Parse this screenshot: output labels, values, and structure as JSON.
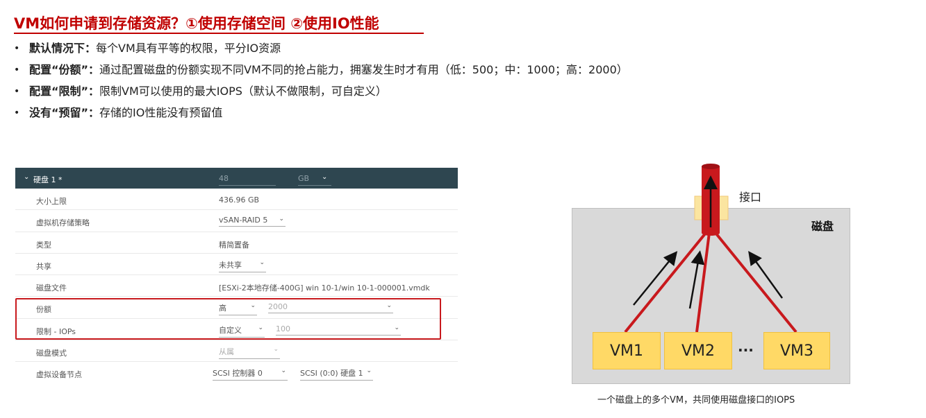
{
  "title": "VM如何申请到存储资源？①使用存储空间  ②使用IO性能",
  "bullets": [
    {
      "key": "默认情况下：",
      "text": "每个VM具有平等的权限，平分IO资源"
    },
    {
      "key": "配置“份额”：",
      "text": "通过配置磁盘的份额实现不同VM不同的抢占能力，拥塞发生时才有用（低：500；中：1000；高：2000）"
    },
    {
      "key": "配置“限制”：",
      "text": "限制VM可以使用的最大IOPS（默认不做限制，可自定义）"
    },
    {
      "key": "没有“预留”：",
      "text": "存储的IO性能没有预留值"
    }
  ],
  "panel": {
    "header": {
      "name": "硬盘 1 *",
      "size": "48",
      "unit": "GB"
    },
    "rows": {
      "max_size": {
        "label": "大小上限",
        "value": "436.96 GB"
      },
      "policy": {
        "label": "虚拟机存储策略",
        "value": "vSAN-RAID 5"
      },
      "type": {
        "label": "类型",
        "value": "精简置备"
      },
      "sharing": {
        "label": "共享",
        "value": "未共享"
      },
      "disk_file": {
        "label": "磁盘文件",
        "value": "[ESXi-2本地存储-400G] win 10-1/win 10-1-000001.vmdk"
      },
      "shares": {
        "label": "份额",
        "value": "高",
        "number": "2000"
      },
      "limit": {
        "label": "限制 - IOPs",
        "value": "自定义",
        "number": "100"
      },
      "disk_mode": {
        "label": "磁盘模式",
        "value": "从属"
      },
      "vdev_node": {
        "label": "虚拟设备节点",
        "controller": "SCSI 控制器 0",
        "slot": "SCSI (0:0) 硬盘 1"
      }
    }
  },
  "diagram": {
    "interface_label": "接口",
    "disk_label": "磁盘",
    "vms": [
      "VM1",
      "VM2",
      "VM3"
    ],
    "ellipsis": "···",
    "caption": "一个磁盘上的多个VM，共同使用磁盘接口的IOPS"
  },
  "colors": {
    "title": "#c00000",
    "accent_red": "#c8191d",
    "vm_fill": "#ffd966",
    "disk_bg": "#d9d9d9",
    "panel_header": "#2e4650"
  }
}
